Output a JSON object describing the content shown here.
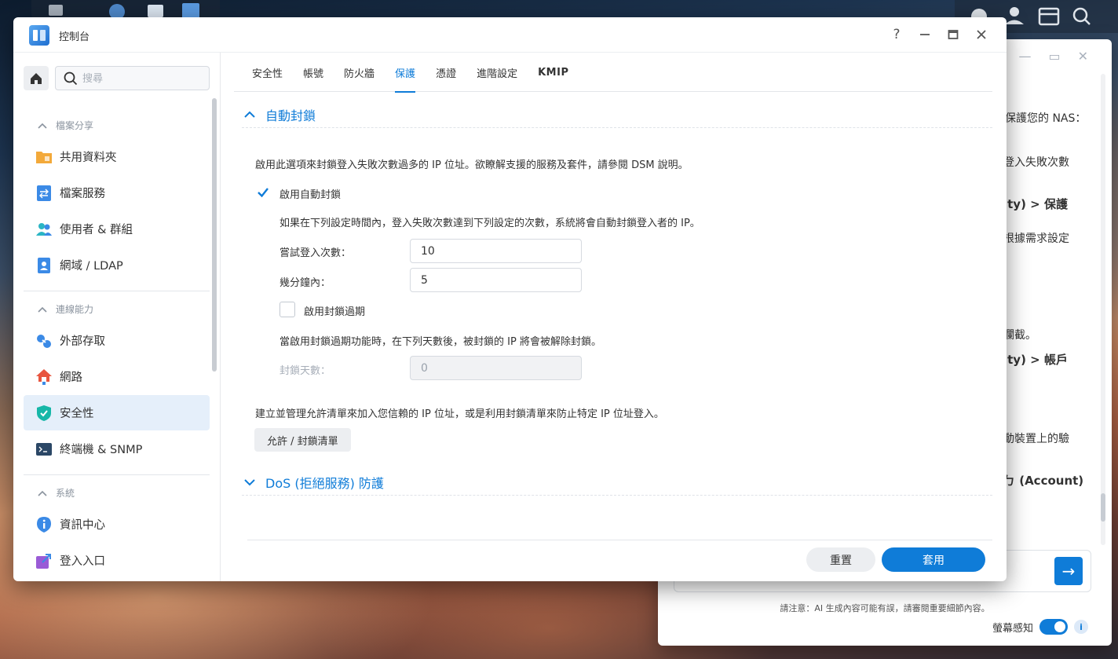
{
  "window": {
    "title": "控制台",
    "help_label": "?"
  },
  "search": {
    "placeholder": "搜尋"
  },
  "sidebar": {
    "sections": [
      {
        "label": "檔案分享"
      },
      {
        "label": "連線能力"
      },
      {
        "label": "系統"
      }
    ],
    "items": [
      {
        "label": "共用資料夾",
        "icon": "folder-icon"
      },
      {
        "label": "檔案服務",
        "icon": "file-services-icon"
      },
      {
        "label": "使用者 & 群組",
        "icon": "users-icon"
      },
      {
        "label": "網域 / LDAP",
        "icon": "domain-icon"
      },
      {
        "label": "外部存取",
        "icon": "external-access-icon"
      },
      {
        "label": "網路",
        "icon": "network-icon"
      },
      {
        "label": "安全性",
        "icon": "shield-icon",
        "active": true
      },
      {
        "label": "終端機 & SNMP",
        "icon": "terminal-icon"
      },
      {
        "label": "資訊中心",
        "icon": "info-icon"
      },
      {
        "label": "登入入口",
        "icon": "login-portal-icon"
      }
    ]
  },
  "tabs": [
    {
      "label": "安全性"
    },
    {
      "label": "帳號"
    },
    {
      "label": "防火牆"
    },
    {
      "label": "保護",
      "active": true
    },
    {
      "label": "憑證"
    },
    {
      "label": "進階設定"
    },
    {
      "label": "KMIP"
    }
  ],
  "auto_block": {
    "heading": "自動封鎖",
    "description": "啟用此選項來封鎖登入失敗次數過多的 IP 位址。欲瞭解支援的服務及套件，請參閱 DSM 說明。",
    "enable_label": "啟用自動封鎖",
    "enable_checked": true,
    "rule_text": "如果在下列設定時間內，登入失敗次數達到下列設定的次數，系統將會自動封鎖登入者的 IP。",
    "attempts_label": "嘗試登入次數：",
    "attempts_value": "10",
    "minutes_label": "幾分鐘內：",
    "minutes_value": "5",
    "expire_label": "啟用封鎖過期",
    "expire_checked": false,
    "expire_text": "當啟用封鎖過期功能時，在下列天數後，被封鎖的 IP 將會被解除封鎖。",
    "days_label": "封鎖天數：",
    "days_value": "0",
    "list_text": "建立並管理允許清單來加入您信賴的 IP 位址，或是利用封鎖清單來防止特定 IP 位址登入。",
    "list_button": "允許 / 封鎖清單"
  },
  "dos": {
    "heading": "DoS (拒絕服務) 防護"
  },
  "footer": {
    "reset_label": "重置",
    "apply_label": "套用"
  },
  "assistant": {
    "fragments": [
      "保護您的 NAS：",
      "登入失敗次數",
      "ity) > 保護",
      "根據需求設定",
      "攔截。",
      "ity) > 帳戶",
      "動裝置上的驗",
      "ㄅ (Account)"
    ],
    "send_icon": "arrow-right-icon",
    "notice": "請注意：AI 生成內容可能有誤，請審閱重要細節內容。",
    "screen_aware_label": "螢幕感知",
    "screen_aware_on": true
  },
  "colors": {
    "accent": "#0f7cd8",
    "active_bg": "#e5effa"
  }
}
